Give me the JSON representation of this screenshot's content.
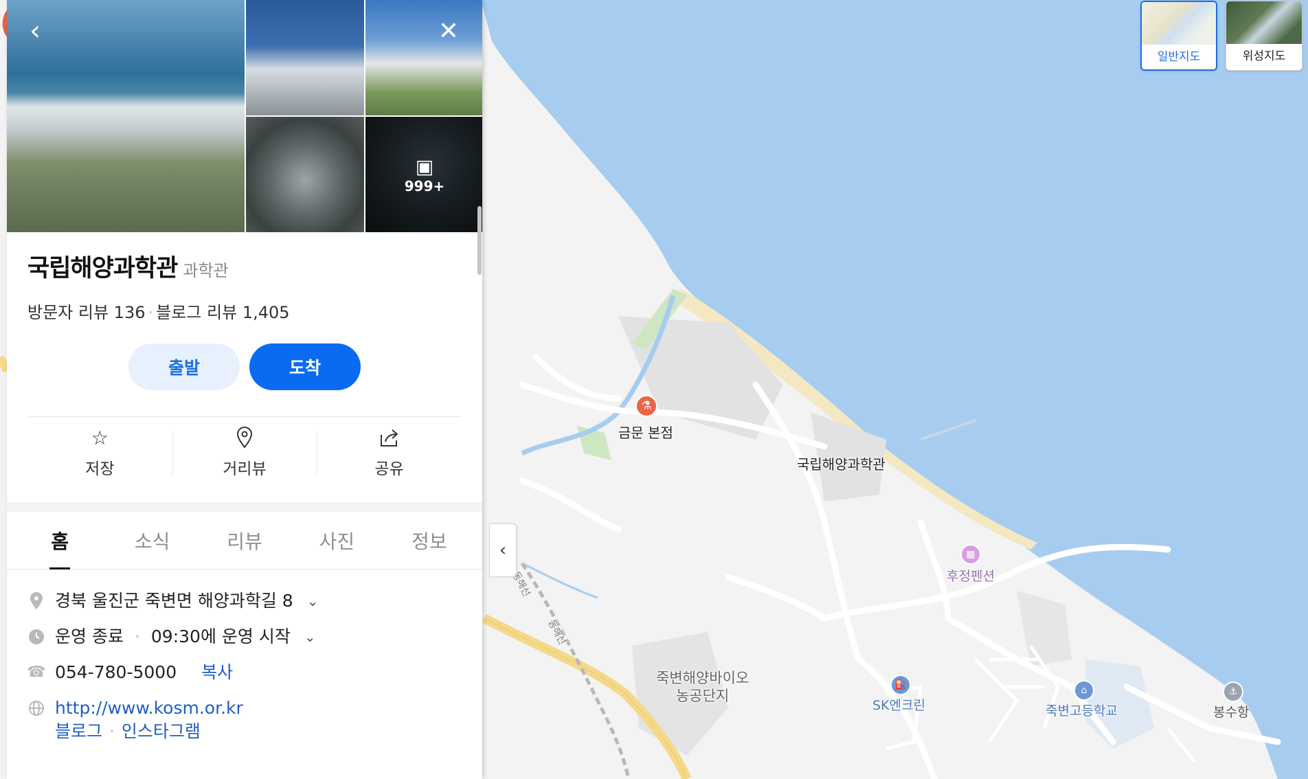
{
  "panel": {
    "photo_count": "999+",
    "title": "국립해양과학관",
    "category": "과학관",
    "visitor_reviews_label": "방문자 리뷰",
    "visitor_reviews_count": "136",
    "blog_reviews_label": "블로그 리뷰",
    "blog_reviews_count": "1,405",
    "depart_label": "출발",
    "arrive_label": "도착",
    "actions": {
      "save": "저장",
      "streetview": "거리뷰",
      "share": "공유"
    },
    "tabs": [
      "홈",
      "소식",
      "리뷰",
      "사진",
      "정보"
    ],
    "address": "경북 울진군 죽변면 해양과학길 8",
    "hours_status": "운영 종료",
    "hours_detail": "09:30에 운영 시작",
    "phone": "054-780-5000",
    "copy_label": "복사",
    "website": "http://www.kosm.or.kr",
    "blog_link": "블로그",
    "instagram_link": "인스타그램"
  },
  "map": {
    "labels": {
      "restaurant": "금문 본점",
      "museum": "국립해양과학관",
      "pension": "후정펜션",
      "bio_complex": "죽변해양바이오\n농공단지",
      "gas_station": "SK엔크린",
      "school": "죽변고등학교",
      "harbor": "봉수항",
      "rail1": "동해선",
      "rail2": "동해선"
    },
    "maptypes": {
      "normal": "일반지도",
      "satellite": "위성지도"
    },
    "colors": {
      "sea": "#a6cdef",
      "land": "#f3f3f3",
      "pin": "#ee6245",
      "accent": "#1f6fe0"
    }
  }
}
